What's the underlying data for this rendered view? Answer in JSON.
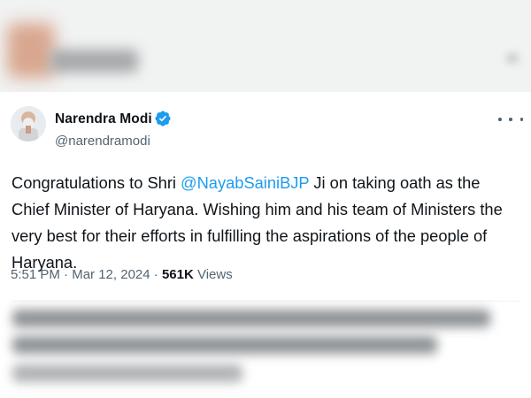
{
  "tweet": {
    "author": {
      "name": "Narendra Modi",
      "handle": "@narendramodi",
      "verified": true
    },
    "text": {
      "before": "Congratulations to Shri ",
      "mention": "@NayabSainiBJP",
      "after": " Ji on taking oath as the Chief Minister of Haryana. Wishing him and his team of Ministers the very best for their efforts in fulfilling the aspirations of the people of Haryana."
    },
    "meta": {
      "time": "5:51 PM",
      "separator": "·",
      "date": "Mar 12, 2024",
      "views_count": "561K",
      "views_label": "Views"
    }
  },
  "colors": {
    "mention": "#1d9bf0",
    "verified_badge": "#1d9bf0",
    "secondary_text": "#536471",
    "primary_text": "#0f1419"
  },
  "icons": {
    "verified": "verified-badge-icon",
    "more": "more-options-icon"
  }
}
